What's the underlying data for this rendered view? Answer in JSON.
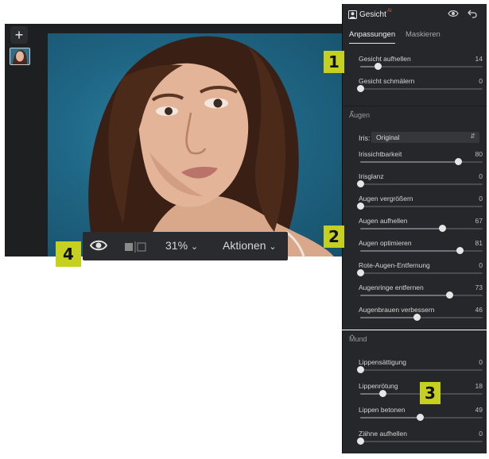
{
  "editor": {
    "add_label": "+",
    "zoom_label": "31%",
    "actions_label": "Aktionen",
    "eye_icon": "eye-icon",
    "compare_icon": "compare-icon"
  },
  "panel": {
    "title": "Gesicht",
    "title_badge": "AI",
    "tabs": [
      "Anpassungen",
      "Maskieren"
    ],
    "face_sliders": [
      {
        "label": "Gesicht aufhellen",
        "value": "14",
        "pos": 0.14
      },
      {
        "label": "Gesicht schmälern",
        "value": "0",
        "pos": 0.0
      }
    ],
    "eyes_section": "Augen",
    "iris_label": "Iris:",
    "iris_value": "Original",
    "eye_sliders": [
      {
        "label": "Irissichtbarkeit",
        "value": "80",
        "pos": 0.8
      },
      {
        "label": "Irisglanz",
        "value": "0",
        "pos": 0.0
      },
      {
        "label": "Augen vergrößern",
        "value": "0",
        "pos": 0.0
      },
      {
        "label": "Augen aufhellen",
        "value": "67",
        "pos": 0.67
      },
      {
        "label": "Augen optimieren",
        "value": "81",
        "pos": 0.81
      },
      {
        "label": "Rote-Augen-Entfernung",
        "value": "0",
        "pos": 0.0
      },
      {
        "label": "Augenringe entfernen",
        "value": "73",
        "pos": 0.73
      },
      {
        "label": "Augenbrauen verbessern",
        "value": "46",
        "pos": 0.46
      }
    ],
    "mouth_section": "Mund",
    "mouth_sliders": [
      {
        "label": "Lippensättigung",
        "value": "0",
        "pos": 0.0
      },
      {
        "label": "Lippenrötung",
        "value": "18",
        "pos": 0.18
      },
      {
        "label": "Lippen betonen",
        "value": "49",
        "pos": 0.49
      },
      {
        "label": "Zähne aufhellen",
        "value": "0",
        "pos": 0.0
      }
    ]
  },
  "markers": [
    "1",
    "2",
    "3",
    "4"
  ],
  "colors": {
    "accent_marker": "#c5d01f",
    "panel_bg": "#25272a",
    "photo_bg": "#1f6685"
  }
}
